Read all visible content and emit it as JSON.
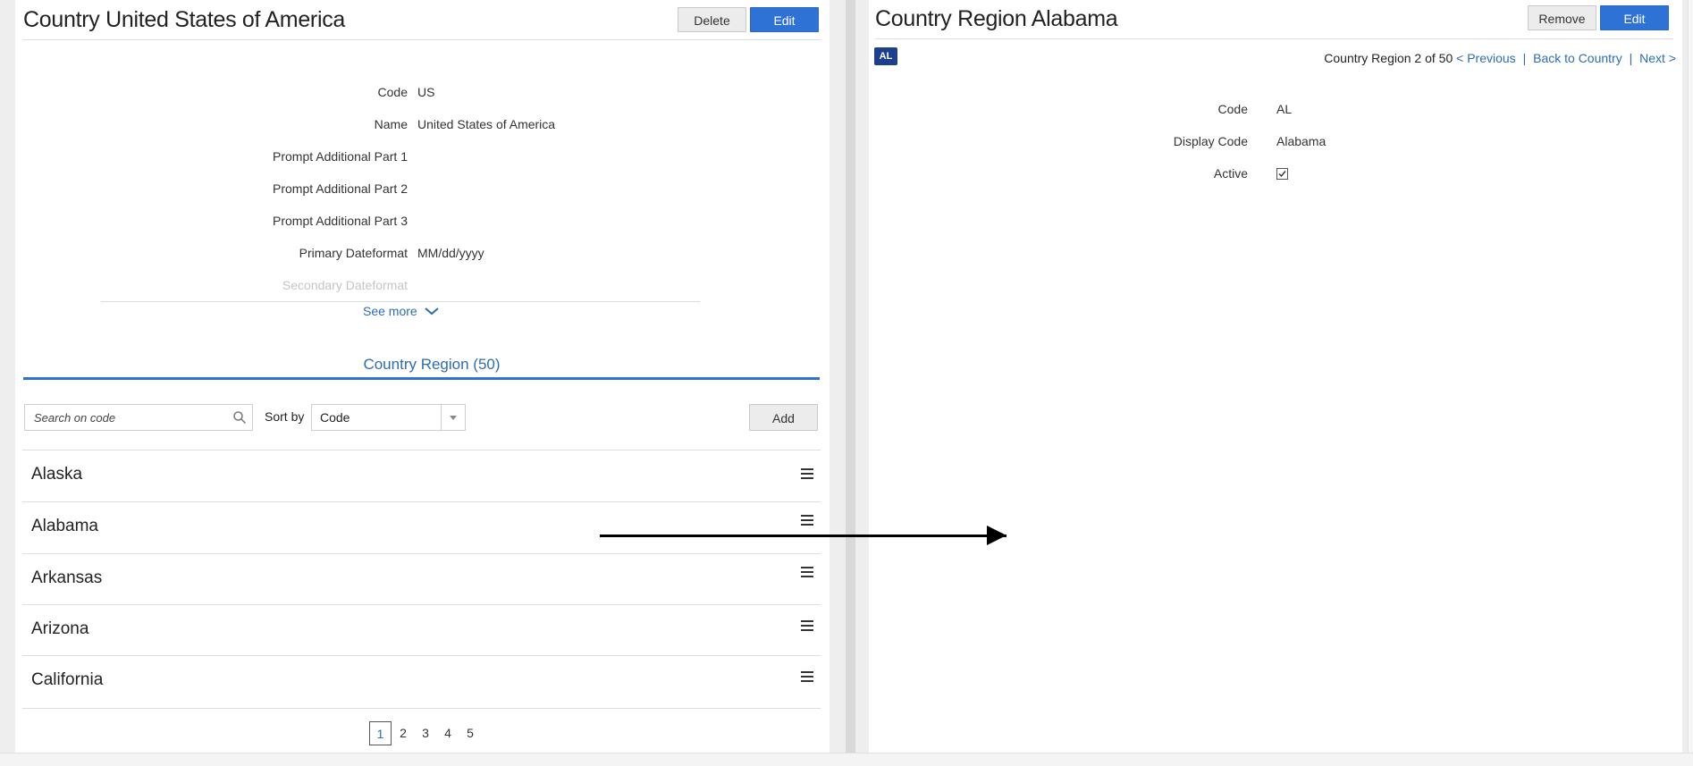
{
  "left": {
    "title": "Country United States of America",
    "delete_label": "Delete",
    "edit_label": "Edit",
    "fields": [
      {
        "label": "Code",
        "value": "US"
      },
      {
        "label": "Name",
        "value": "United States of America"
      },
      {
        "label": "Prompt Additional Part 1",
        "value": ""
      },
      {
        "label": "Prompt Additional Part 2",
        "value": ""
      },
      {
        "label": "Prompt Additional Part 3",
        "value": ""
      },
      {
        "label": "Primary Dateformat",
        "value": "MM/dd/yyyy"
      },
      {
        "label": "Secondary Dateformat",
        "value": ""
      }
    ],
    "see_more": "See more",
    "tab_label": "Country Region (50)",
    "search_placeholder": "Search on code",
    "sort_label": "Sort by",
    "sort_value": "Code",
    "add_label": "Add",
    "rows": [
      "Alaska",
      "Alabama",
      "Arkansas",
      "Arizona",
      "California"
    ],
    "pages": [
      "1",
      "2",
      "3",
      "4",
      "5"
    ],
    "active_page": "1"
  },
  "right": {
    "title": "Country Region Alabama",
    "remove_label": "Remove",
    "edit_label": "Edit",
    "badge": "AL",
    "nav": {
      "position_text": "Country Region 2 of 50",
      "previous": "< Previous",
      "back": "Back to Country",
      "next": "Next >",
      "separator": "|"
    },
    "fields": [
      {
        "label": "Code",
        "value": "AL"
      },
      {
        "label": "Display Code",
        "value": "Alabama"
      },
      {
        "label": "Active",
        "value": ""
      }
    ],
    "active_checked": true
  },
  "icons": {
    "search": "search-icon",
    "dropdown": "chevron-down-icon",
    "see_more": "chevron-down-icon",
    "row_menu": "menu-icon",
    "checkbox": "checkbox-checked-icon"
  },
  "colors": {
    "accent": "#2f72d6",
    "link": "#2c6cb6",
    "badge": "#1d3f8f"
  }
}
